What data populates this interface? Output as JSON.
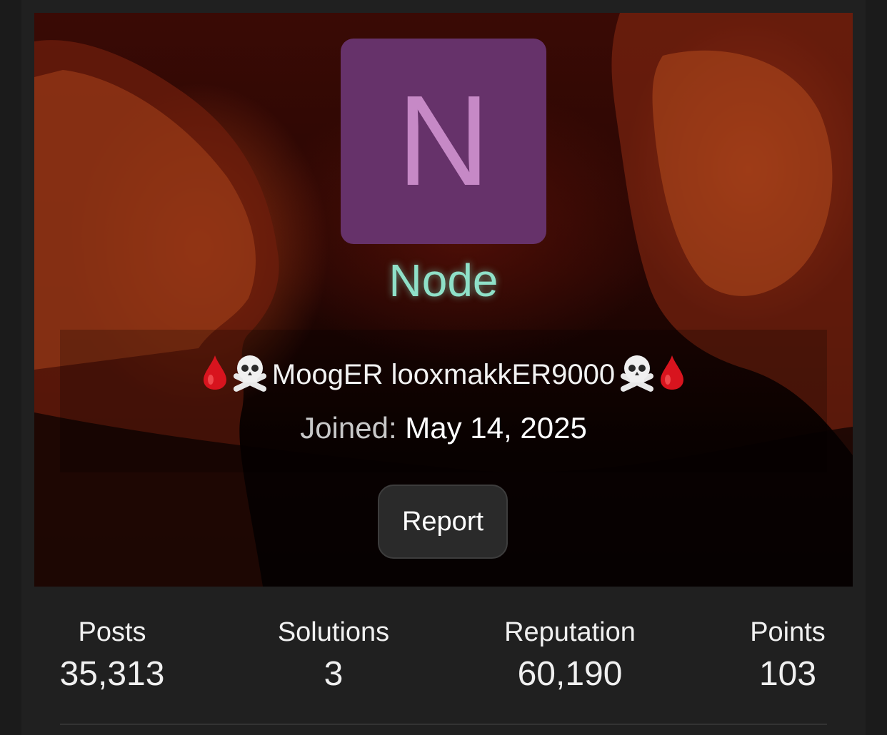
{
  "profile": {
    "avatar_letter": "N",
    "avatar_bg": "#66326a",
    "avatar_fg": "#c689c6",
    "display_name": "Node",
    "display_name_color": "#8fe0c8",
    "custom_title": "MoogER looxmakkER9000",
    "title_icons": [
      "drop-of-blood-icon",
      "skull-and-crossbones-icon"
    ],
    "joined_label": "Joined:",
    "joined_value": "May 14, 2025",
    "report_label": "Report"
  },
  "stats": [
    {
      "label": "Posts",
      "value": "35,313"
    },
    {
      "label": "Solutions",
      "value": "3"
    },
    {
      "label": "Reputation",
      "value": "60,190"
    },
    {
      "label": "Points",
      "value": "103"
    }
  ]
}
